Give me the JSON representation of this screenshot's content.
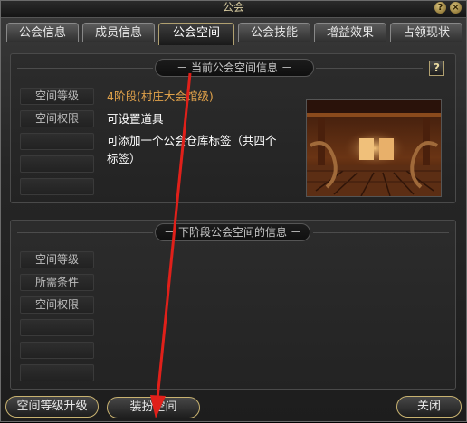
{
  "window": {
    "title": "公会",
    "help_glyph": "?",
    "close_glyph": "×"
  },
  "tabs": [
    {
      "label": "公会信息"
    },
    {
      "label": "成员信息"
    },
    {
      "label": "公会空间"
    },
    {
      "label": "公会技能"
    },
    {
      "label": "增益效果"
    },
    {
      "label": "占领现状"
    }
  ],
  "current": {
    "header": "－ 当前公会空间信息 －",
    "help_glyph": "?",
    "labels": [
      "空间等级",
      "空间权限",
      "",
      "",
      ""
    ],
    "level_value": "4阶段(村庄大会馆级)",
    "permissions": [
      "可设置道具",
      "可添加一个公会仓库标签（共四个",
      "标签）"
    ]
  },
  "next": {
    "header": "－ 下阶段公会空间的信息 －",
    "labels": [
      "空间等级",
      "所需条件",
      "空间权限",
      "",
      "",
      ""
    ]
  },
  "buttons": {
    "upgrade": "空间等级升级",
    "decorate": "装扮空间",
    "close": "关闭"
  }
}
